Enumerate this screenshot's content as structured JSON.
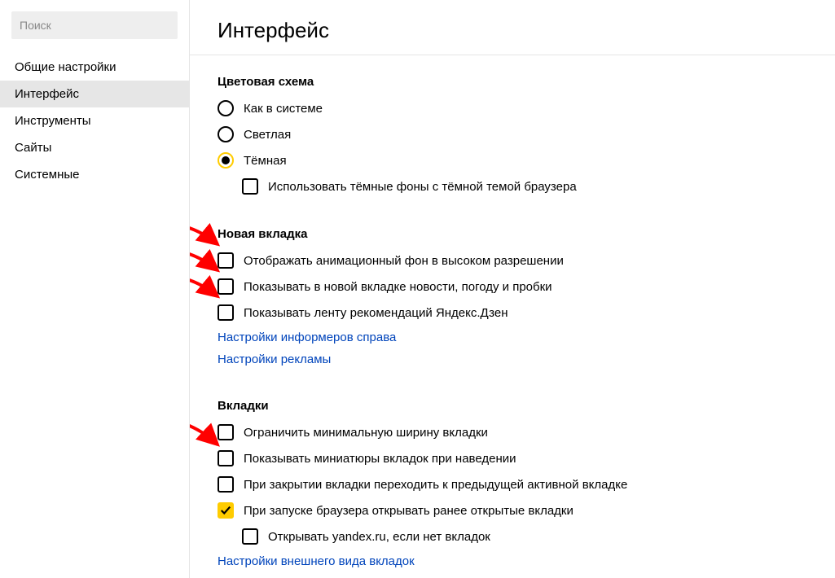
{
  "sidebar": {
    "search_placeholder": "Поиск",
    "items": [
      {
        "label": "Общие настройки",
        "active": false
      },
      {
        "label": "Интерфейс",
        "active": true
      },
      {
        "label": "Инструменты",
        "active": false
      },
      {
        "label": "Сайты",
        "active": false
      },
      {
        "label": "Системные",
        "active": false
      }
    ]
  },
  "page": {
    "title": "Интерфейс"
  },
  "color_scheme": {
    "title": "Цветовая схема",
    "options": [
      {
        "label": "Как в системе",
        "selected": false
      },
      {
        "label": "Светлая",
        "selected": false
      },
      {
        "label": "Тёмная",
        "selected": true
      }
    ],
    "dark_bg_checkbox": {
      "label": "Использовать тёмные фоны с тёмной темой браузера",
      "checked": false
    }
  },
  "new_tab": {
    "title": "Новая вкладка",
    "options": [
      {
        "label": "Отображать анимационный фон в высоком разрешении",
        "checked": false
      },
      {
        "label": "Показывать в новой вкладке новости, погоду и пробки",
        "checked": false
      },
      {
        "label": "Показывать ленту рекомендаций Яндекс.Дзен",
        "checked": false
      }
    ],
    "links": [
      "Настройки информеров справа",
      "Настройки рекламы"
    ]
  },
  "tabs_section": {
    "title": "Вкладки",
    "options": [
      {
        "label": "Ограничить минимальную ширину вкладки",
        "checked": false,
        "indent": false
      },
      {
        "label": "Показывать миниатюры вкладок при наведении",
        "checked": false,
        "indent": false
      },
      {
        "label": "При закрытии вкладки переходить к предыдущей активной вкладке",
        "checked": false,
        "indent": false
      },
      {
        "label": "При запуске браузера открывать ранее открытые вкладки",
        "checked": true,
        "indent": false
      },
      {
        "label": "Открывать yandex.ru, если нет вкладок",
        "checked": false,
        "indent": true
      }
    ],
    "link": "Настройки внешнего вида вкладок"
  }
}
